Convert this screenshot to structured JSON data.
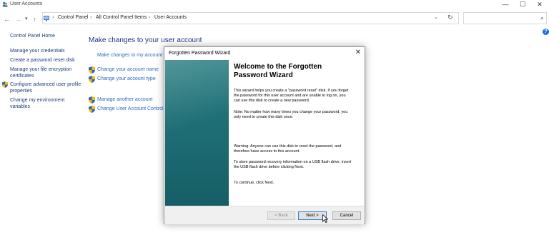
{
  "window": {
    "title": "User Accounts",
    "controls": {
      "minimize": "—",
      "maximize": "☐",
      "close": "✕"
    }
  },
  "nav": {
    "back": "←",
    "forward": "→",
    "recent": "▾",
    "up": "↑",
    "breadcrumb": [
      "Control Panel",
      "All Control Panel Items",
      "User Accounts"
    ],
    "separator": "›",
    "dropdown": "⌄",
    "refresh": "↻",
    "search_placeholder": "",
    "search_icon": "⌕"
  },
  "sidebar": {
    "items": [
      {
        "label": "Control Panel Home"
      },
      {
        "label": "Manage your credentials"
      },
      {
        "label": "Create a password reset disk"
      },
      {
        "label": "Manage your file encryption certificates"
      },
      {
        "label": "Configure advanced user profile properties"
      },
      {
        "label": "Change my environment variables"
      }
    ]
  },
  "main": {
    "title": "Make changes to your user account",
    "links": [
      {
        "label": "Make changes to my account in"
      },
      {
        "label": "Change your account name"
      },
      {
        "label": "Change your account type"
      },
      {
        "label": "Manage another account"
      },
      {
        "label": "Change User Account Control s"
      }
    ],
    "help": "?"
  },
  "dialog": {
    "title": "Forgotten Password Wizard",
    "close": "✕",
    "heading": "Welcome to the Forgotten Password Wizard",
    "paragraphs": [
      "This wizard helps you create a \"password reset\" disk. If you forget the password for this user account and are unable to log on, you can use this disk to create a new password.",
      "Note: No matter how many times you change your password, you only need to create this disk once.",
      "Warning: Anyone can use this disk to reset the password, and therefore have access to this account.",
      "To store password recovery information on a USB flash drive, insert the USB flash drive before clicking Next.",
      "To continue, click Next."
    ],
    "buttons": {
      "back": "< Back",
      "next": "Next >",
      "cancel": "Cancel"
    }
  },
  "colors": {
    "link": "#1a3d7c",
    "main_title": "#1e3287",
    "main_link": "#2e6bc6",
    "wizard_side": "#1f6f77",
    "default_button_border": "#2f7fd6"
  }
}
